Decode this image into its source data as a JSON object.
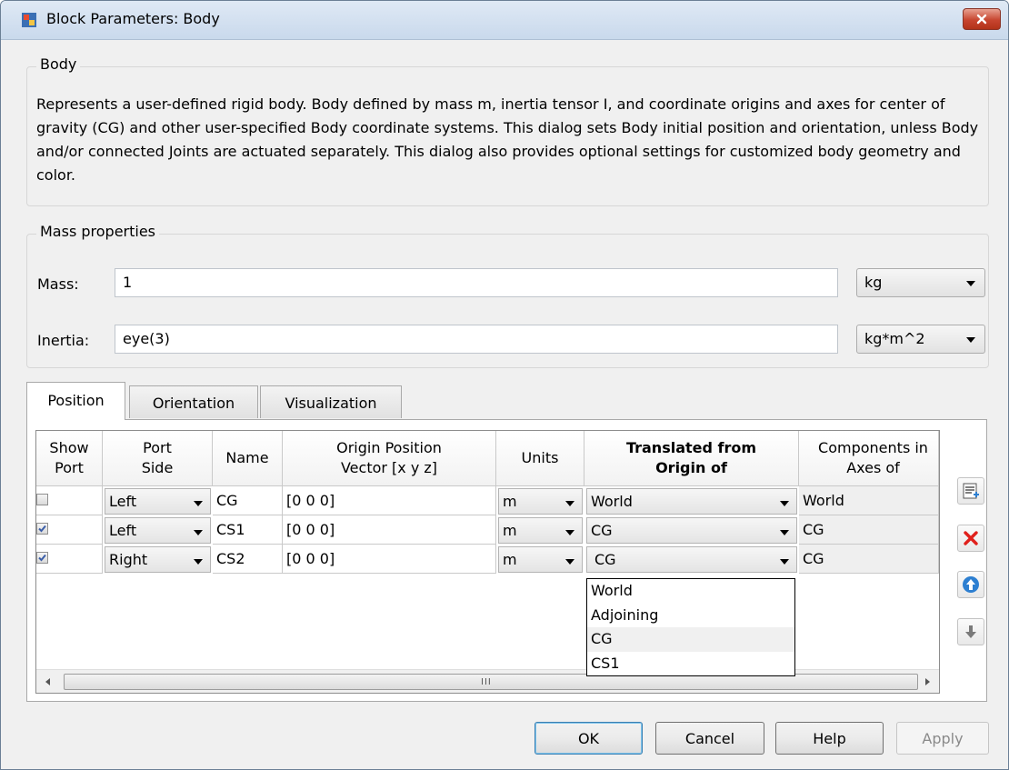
{
  "window": {
    "title": "Block Parameters: Body"
  },
  "body_group": {
    "title": "Body",
    "description": "Represents a user-defined rigid body. Body defined by mass m, inertia tensor I, and coordinate origins and axes for center of gravity (CG) and other user-specified Body coordinate systems. This dialog sets Body initial position and orientation, unless Body and/or connected Joints are actuated separately. This dialog also provides optional settings for customized body geometry and color."
  },
  "mass_properties": {
    "title": "Mass properties",
    "mass_label": "Mass:",
    "mass_value": "1",
    "mass_units": "kg",
    "inertia_label": "Inertia:",
    "inertia_value": "eye(3)",
    "inertia_units": "kg*m^2"
  },
  "tabs": [
    {
      "label": "Position",
      "active": true
    },
    {
      "label": "Orientation",
      "active": false
    },
    {
      "label": "Visualization",
      "active": false
    }
  ],
  "table": {
    "headers": [
      "Show Port",
      "Port Side",
      "Name",
      "Origin Position Vector [x y z]",
      "Units",
      "Translated from Origin of",
      "Components in Axes of"
    ],
    "rows": [
      {
        "show_port": false,
        "port_side": "Left",
        "name": "CG",
        "vector": "[0 0 0]",
        "units": "m",
        "translated_from": "World",
        "components_in": "World"
      },
      {
        "show_port": true,
        "port_side": "Left",
        "name": "CS1",
        "vector": "[0 0 0]",
        "units": "m",
        "translated_from": "CG",
        "components_in": "CG"
      },
      {
        "show_port": true,
        "port_side": "Right",
        "name": "CS2",
        "vector": "[0 0 0]",
        "units": "m",
        "translated_from": "CG",
        "components_in": "CG"
      }
    ],
    "dropdown_options": [
      "World",
      "Adjoining",
      "CG",
      "CS1"
    ],
    "dropdown_highlighted": "CG",
    "scroll_grip": "III"
  },
  "side_buttons": [
    "add-row-icon",
    "delete-icon",
    "move-up-icon",
    "move-down-icon"
  ],
  "buttons": {
    "ok": "OK",
    "cancel": "Cancel",
    "help": "Help",
    "apply": "Apply"
  },
  "colors": {
    "delete_red": "#e0201b",
    "arrow_blue": "#2d7fd1",
    "close_red": "#c7452f"
  }
}
